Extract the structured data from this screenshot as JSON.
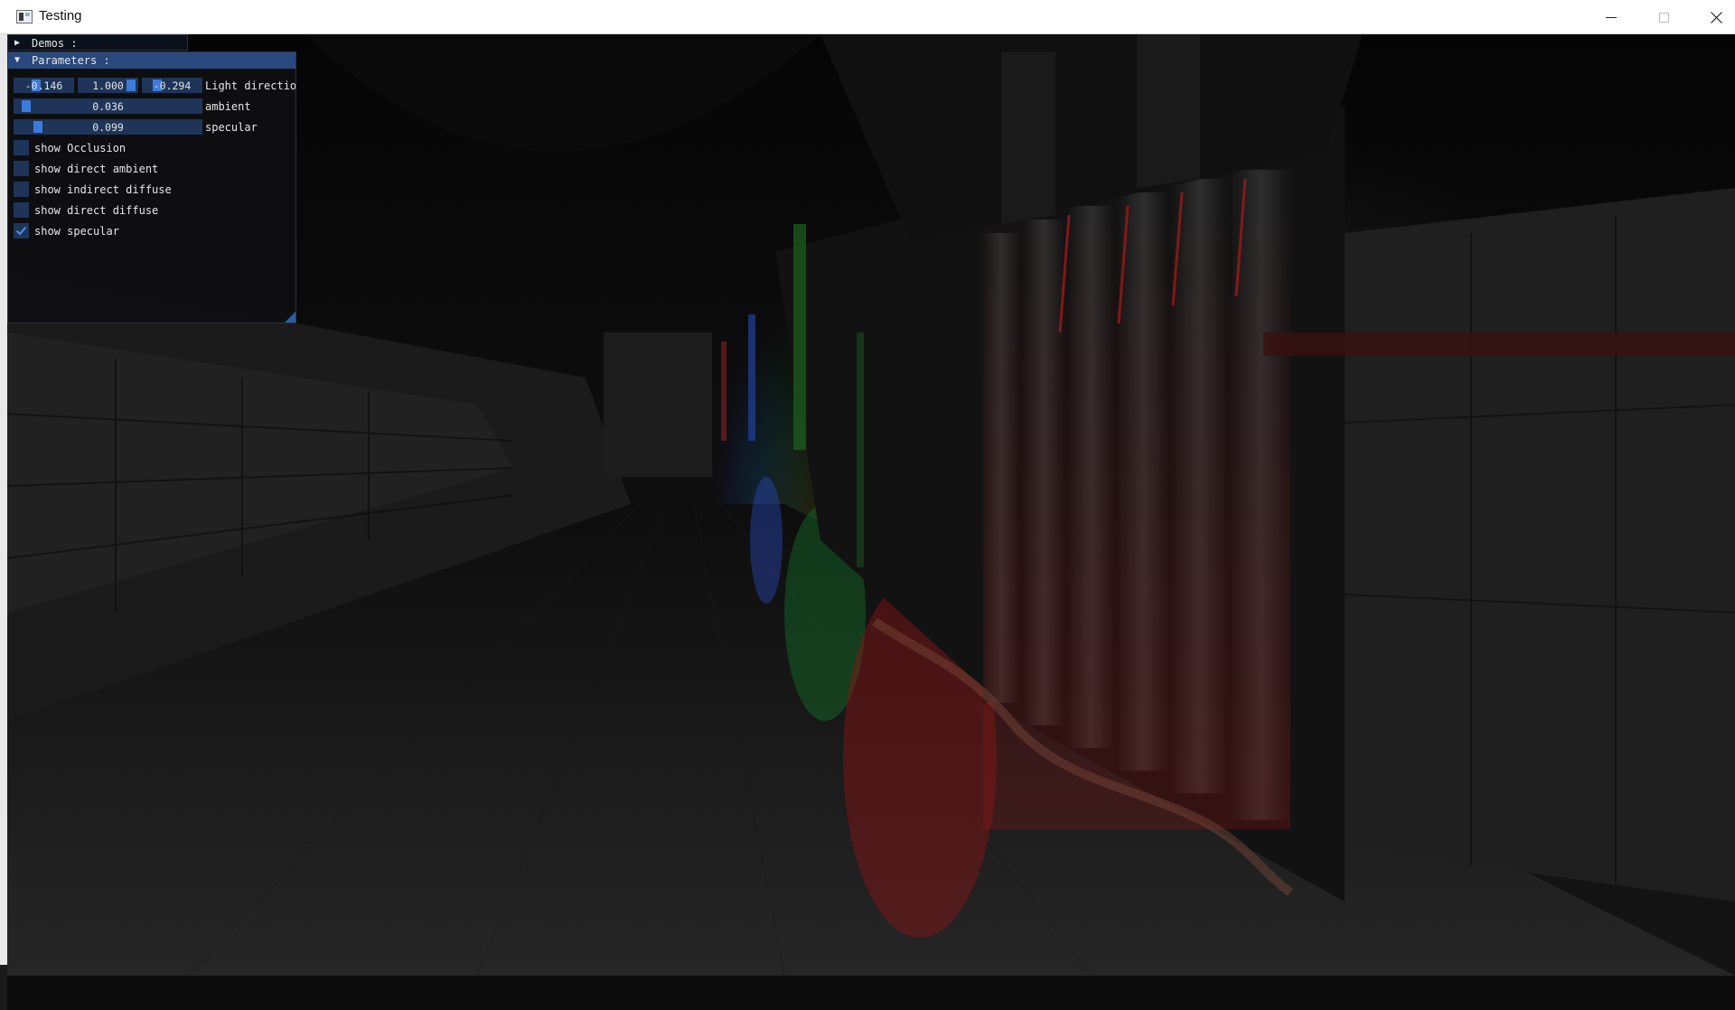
{
  "window": {
    "title": "Testing",
    "icon": "app-window-icon",
    "controls": [
      "minimize-icon",
      "maximize-icon",
      "close-icon"
    ]
  },
  "demos": {
    "label": "Demos :",
    "expanded": false
  },
  "parameters": {
    "label": "Parameters :",
    "expanded": true,
    "light_direction": {
      "label": "Light direction",
      "x": "-0.146",
      "y": "1.000",
      "z": "-0.294"
    },
    "ambient": {
      "label": "ambient",
      "value": "0.036"
    },
    "specular": {
      "label": "specular",
      "value": "0.099"
    },
    "checkboxes": [
      {
        "label": "show Occlusion",
        "checked": false
      },
      {
        "label": "show direct ambient",
        "checked": false
      },
      {
        "label": "show indirect diffuse",
        "checked": false
      },
      {
        "label": "show direct diffuse",
        "checked": false
      },
      {
        "label": "show specular",
        "checked": true
      }
    ]
  },
  "colors": {
    "title_active": "#28487e",
    "frame_bg": "#1e3559",
    "slider_grab": "#3d7bd9",
    "checkmark": "#4a8fe7",
    "window_bg": "#0f0f12"
  }
}
